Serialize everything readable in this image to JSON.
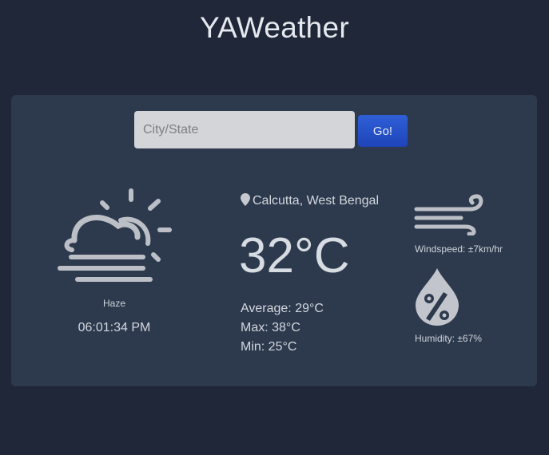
{
  "app": {
    "title": "YAWeather"
  },
  "search": {
    "placeholder": "City/State",
    "value": "",
    "button_label": "Go!"
  },
  "weather": {
    "condition": "Haze",
    "time": "06:01:34 PM",
    "location": "Calcutta, West Bengal",
    "temperature": "32°C",
    "average": "Average: 29°C",
    "max": "Max: 38°C",
    "min": "Min: 25°C",
    "windspeed": "Windspeed: ±7km/hr",
    "humidity": "Humidity: ±67%"
  },
  "icons": {
    "condition": "haze-icon",
    "location": "map-pin-icon",
    "wind": "wind-icon",
    "humidity": "humidity-drop-icon"
  },
  "colors": {
    "background": "#1f2739",
    "card": "#2d3a4d",
    "button": "#2451c9",
    "icon": "#bcc0c6"
  }
}
